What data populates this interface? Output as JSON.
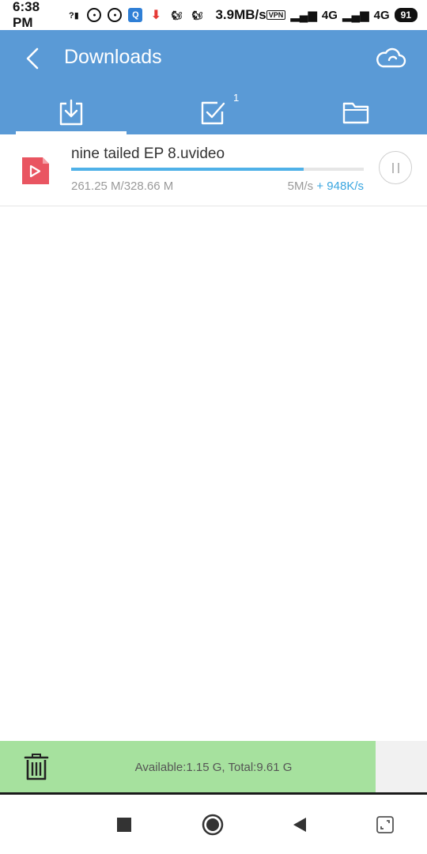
{
  "status_bar": {
    "time": "6:38 PM",
    "speed": "3.9MB/s",
    "vpn": "VPN",
    "net1": "4G",
    "net2": "4G",
    "battery": "91"
  },
  "header": {
    "title": "Downloads",
    "tabs": [
      {
        "name": "downloading",
        "icon": "download-icon"
      },
      {
        "name": "completed",
        "icon": "check-box-icon",
        "badge": "1"
      },
      {
        "name": "files",
        "icon": "folder-icon"
      }
    ],
    "active_tab": 0
  },
  "downloads": [
    {
      "file_name": "nine tailed EP 8.uvideo",
      "progress_text": "261.25 M/328.66 M",
      "progress": 0.795,
      "speed": "5M/s",
      "boost": "+ 948K/s",
      "icon": "video-file-icon",
      "action": "pause"
    }
  ],
  "storage": {
    "text": "Available:1.15 G, Total:9.61 G",
    "used_fraction": 0.88
  },
  "colors": {
    "app_bar": "#5a9ad6",
    "progress": "#4fb1e8",
    "storage_used": "#a6e19e",
    "video_icon": "#e95561"
  }
}
